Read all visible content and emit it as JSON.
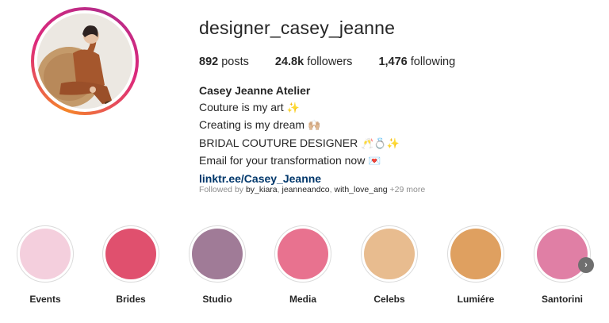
{
  "profile": {
    "username": "designer_casey_jeanne",
    "stats": {
      "posts_count": "892",
      "posts_label": " posts",
      "followers_count": "24.8k",
      "followers_label": " followers",
      "following_count": "1,476",
      "following_label": " following"
    },
    "bio": {
      "name": "Casey Jeanne Atelier",
      "line1": "Couture is my art",
      "line1_emoji": "✨",
      "line2": "Creating is my dream",
      "line2_emoji": "🙌🏼",
      "line3": "BRIDAL COUTURE DESIGNER",
      "line3_emoji": "🥂💍✨",
      "line4": "Email for your transformation now",
      "line4_emoji": "💌",
      "link": "linktr.ee/Casey_Jeanne"
    },
    "followed_by": {
      "prefix": "Followed by ",
      "name1": "by_kiara",
      "sep1": ", ",
      "name2": "jeanneandco",
      "sep2": ", ",
      "name3": "with_love_ang",
      "more": " +29 more"
    }
  },
  "highlights": [
    {
      "label": "Events",
      "color": "#f4cfdd"
    },
    {
      "label": "Brides",
      "color": "#e0506e"
    },
    {
      "label": "Studio",
      "color": "#a07b97"
    },
    {
      "label": "Media",
      "color": "#e8728f"
    },
    {
      "label": "Celebs",
      "color": "#e8bc8f"
    },
    {
      "label": "Lumiére",
      "color": "#dfa060"
    },
    {
      "label": "Santorini",
      "color": "#e07fa5"
    }
  ],
  "icons": {
    "next": "chevron-right-icon"
  },
  "next_glyph": "›"
}
